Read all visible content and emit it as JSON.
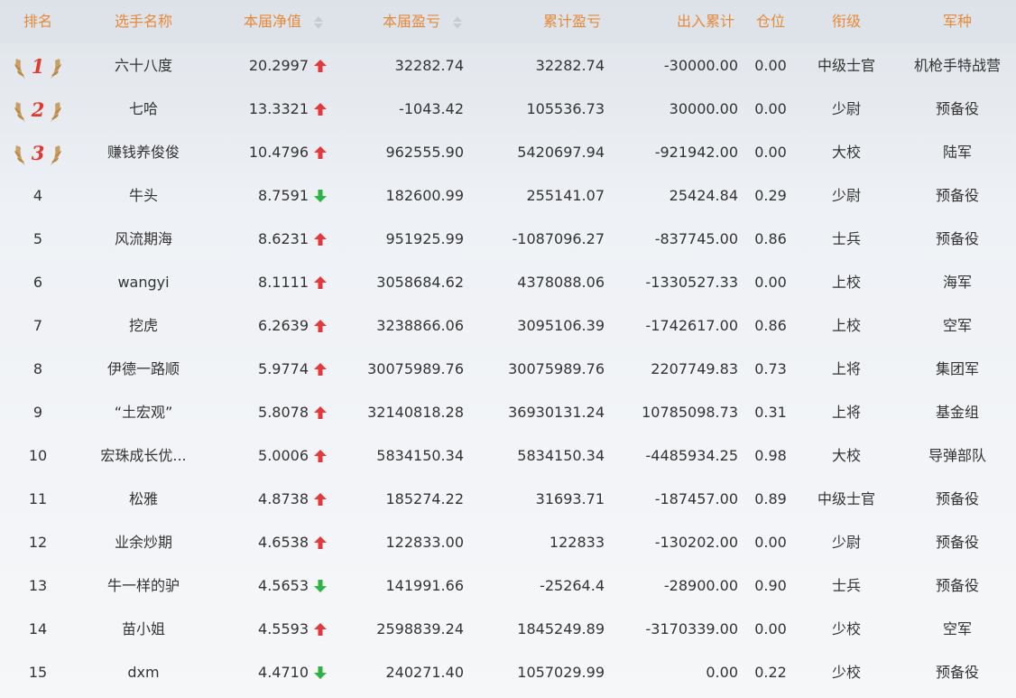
{
  "header": {
    "rank": "排名",
    "name": "选手名称",
    "nav": "本届净值",
    "pl": "本届盈亏",
    "cum": "累计盈亏",
    "io": "出入累计",
    "pos": "仓位",
    "grade": "衔级",
    "arm": "军种"
  },
  "icons": {
    "up": "red-up-arrow-icon",
    "down": "green-down-arrow-icon",
    "sort": "sort-icon",
    "medal": "laurel-medal-icon"
  },
  "colors": {
    "header_text": "#e6893a",
    "up": "#e4393c",
    "down": "#2fb342",
    "medal_number": "#e23a2e",
    "laurel": "#c9a063"
  },
  "rows": [
    {
      "rank": "1",
      "name": "六十八度",
      "nav": "20.2997",
      "trend": "up",
      "pl": "32282.74",
      "cum": "32282.74",
      "io": "-30000.00",
      "pos": "0.00",
      "grade": "中级士官",
      "arm": "机枪手特战营"
    },
    {
      "rank": "2",
      "name": "七哈",
      "nav": "13.3321",
      "trend": "up",
      "pl": "-1043.42",
      "cum": "105536.73",
      "io": "30000.00",
      "pos": "0.00",
      "grade": "少尉",
      "arm": "预备役"
    },
    {
      "rank": "3",
      "name": "赚钱养俊俊",
      "nav": "10.4796",
      "trend": "up",
      "pl": "962555.90",
      "cum": "5420697.94",
      "io": "-921942.00",
      "pos": "0.00",
      "grade": "大校",
      "arm": "陆军"
    },
    {
      "rank": "4",
      "name": "牛头",
      "nav": "8.7591",
      "trend": "down",
      "pl": "182600.99",
      "cum": "255141.07",
      "io": "25424.84",
      "pos": "0.29",
      "grade": "少尉",
      "arm": "预备役"
    },
    {
      "rank": "5",
      "name": "风流期海",
      "nav": "8.6231",
      "trend": "up",
      "pl": "951925.99",
      "cum": "-1087096.27",
      "io": "-837745.00",
      "pos": "0.86",
      "grade": "士兵",
      "arm": "预备役"
    },
    {
      "rank": "6",
      "name": "wangyi",
      "nav": "8.1111",
      "trend": "up",
      "pl": "3058684.62",
      "cum": "4378088.06",
      "io": "-1330527.33",
      "pos": "0.00",
      "grade": "上校",
      "arm": "海军"
    },
    {
      "rank": "7",
      "name": "挖虎",
      "nav": "6.2639",
      "trend": "up",
      "pl": "3238866.06",
      "cum": "3095106.39",
      "io": "-1742617.00",
      "pos": "0.86",
      "grade": "上校",
      "arm": "空军"
    },
    {
      "rank": "8",
      "name": "伊德一路顺",
      "nav": "5.9774",
      "trend": "up",
      "pl": "30075989.76",
      "cum": "30075989.76",
      "io": "2207749.83",
      "pos": "0.73",
      "grade": "上将",
      "arm": "集团军"
    },
    {
      "rank": "9",
      "name": "“土宏观”",
      "nav": "5.8078",
      "trend": "up",
      "pl": "32140818.28",
      "cum": "36930131.24",
      "io": "10785098.73",
      "pos": "0.31",
      "grade": "上将",
      "arm": "基金组"
    },
    {
      "rank": "10",
      "name": "宏珠成长优...",
      "nav": "5.0006",
      "trend": "up",
      "pl": "5834150.34",
      "cum": "5834150.34",
      "io": "-4485934.25",
      "pos": "0.98",
      "grade": "大校",
      "arm": "导弹部队"
    },
    {
      "rank": "11",
      "name": "松雅",
      "nav": "4.8738",
      "trend": "up",
      "pl": "185274.22",
      "cum": "31693.71",
      "io": "-187457.00",
      "pos": "0.89",
      "grade": "中级士官",
      "arm": "预备役"
    },
    {
      "rank": "12",
      "name": "业余炒期",
      "nav": "4.6538",
      "trend": "up",
      "pl": "122833.00",
      "cum": "122833",
      "io": "-130202.00",
      "pos": "0.00",
      "grade": "少尉",
      "arm": "预备役"
    },
    {
      "rank": "13",
      "name": "牛一样的驴",
      "nav": "4.5653",
      "trend": "down",
      "pl": "141991.66",
      "cum": "-25264.4",
      "io": "-28900.00",
      "pos": "0.90",
      "grade": "士兵",
      "arm": "预备役"
    },
    {
      "rank": "14",
      "name": "苗小姐",
      "nav": "4.5593",
      "trend": "up",
      "pl": "2598839.24",
      "cum": "1845249.89",
      "io": "-3170339.00",
      "pos": "0.00",
      "grade": "少校",
      "arm": "空军"
    },
    {
      "rank": "15",
      "name": "dxm",
      "nav": "4.4710",
      "trend": "down",
      "pl": "240271.40",
      "cum": "1057029.99",
      "io": "0.00",
      "pos": "0.22",
      "grade": "少校",
      "arm": "预备役"
    }
  ]
}
